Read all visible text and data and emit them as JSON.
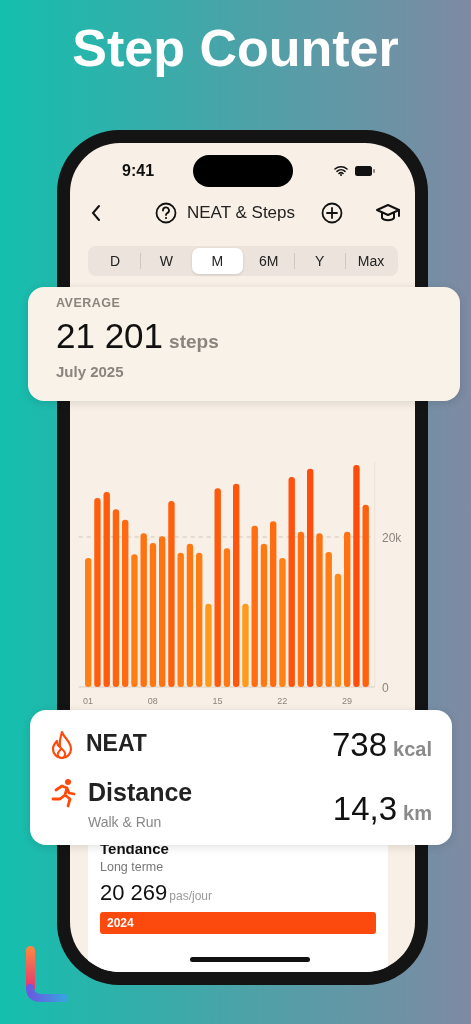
{
  "title": "Step Counter",
  "status_bar": {
    "time": "9:41"
  },
  "nav": {
    "title": "NEAT & Steps"
  },
  "periods": [
    {
      "label": "D",
      "selected": false
    },
    {
      "label": "W",
      "selected": false
    },
    {
      "label": "M",
      "selected": true
    },
    {
      "label": "6M",
      "selected": false
    },
    {
      "label": "Y",
      "selected": false
    },
    {
      "label": "Max",
      "selected": false
    }
  ],
  "average": {
    "label": "AVERAGE",
    "value": "21 201",
    "unit": "steps",
    "period": "July 2025"
  },
  "chart": {
    "chart_data": {
      "type": "bar",
      "x": [
        1,
        2,
        3,
        4,
        5,
        6,
        7,
        8,
        9,
        10,
        11,
        12,
        13,
        14,
        15,
        16,
        17,
        18,
        19,
        20,
        21,
        22,
        23,
        24,
        25,
        26,
        27,
        28,
        29,
        30,
        31
      ],
      "series": [
        {
          "values": [
            17200,
            25200,
            26000,
            23700,
            22300,
            17700,
            20500,
            19200,
            20100,
            24800,
            17900,
            19100,
            17900,
            11100,
            26500,
            18500,
            27100,
            11100,
            21500,
            19100,
            22100,
            17200,
            28000,
            20700,
            29100,
            20500,
            18000,
            15100,
            20700,
            29600,
            24300
          ]
        }
      ],
      "xlim": [
        0,
        32
      ],
      "ylim": [
        0,
        30000
      ],
      "yticks": [
        {
          "value": 0,
          "label": "0"
        },
        {
          "value": 20000,
          "label": "20k"
        }
      ],
      "xticks": [
        {
          "value": 1,
          "label": "01"
        },
        {
          "value": 8,
          "label": "08"
        },
        {
          "value": 15,
          "label": "15"
        },
        {
          "value": 22,
          "label": "22"
        },
        {
          "value": 29,
          "label": "29"
        }
      ]
    }
  },
  "metrics": [
    {
      "kind": "calories",
      "name": "NEAT",
      "value": "738",
      "unit": "kcal"
    },
    {
      "kind": "distance",
      "name": "Distance",
      "subtitle": "Walk & Run",
      "value": "14,3",
      "unit": "km"
    }
  ],
  "trend": {
    "title": "Tendance",
    "subtitle": "Long terme",
    "value": "20 269",
    "unit": "pas/jour",
    "bars": [
      {
        "label": "2024"
      }
    ]
  }
}
